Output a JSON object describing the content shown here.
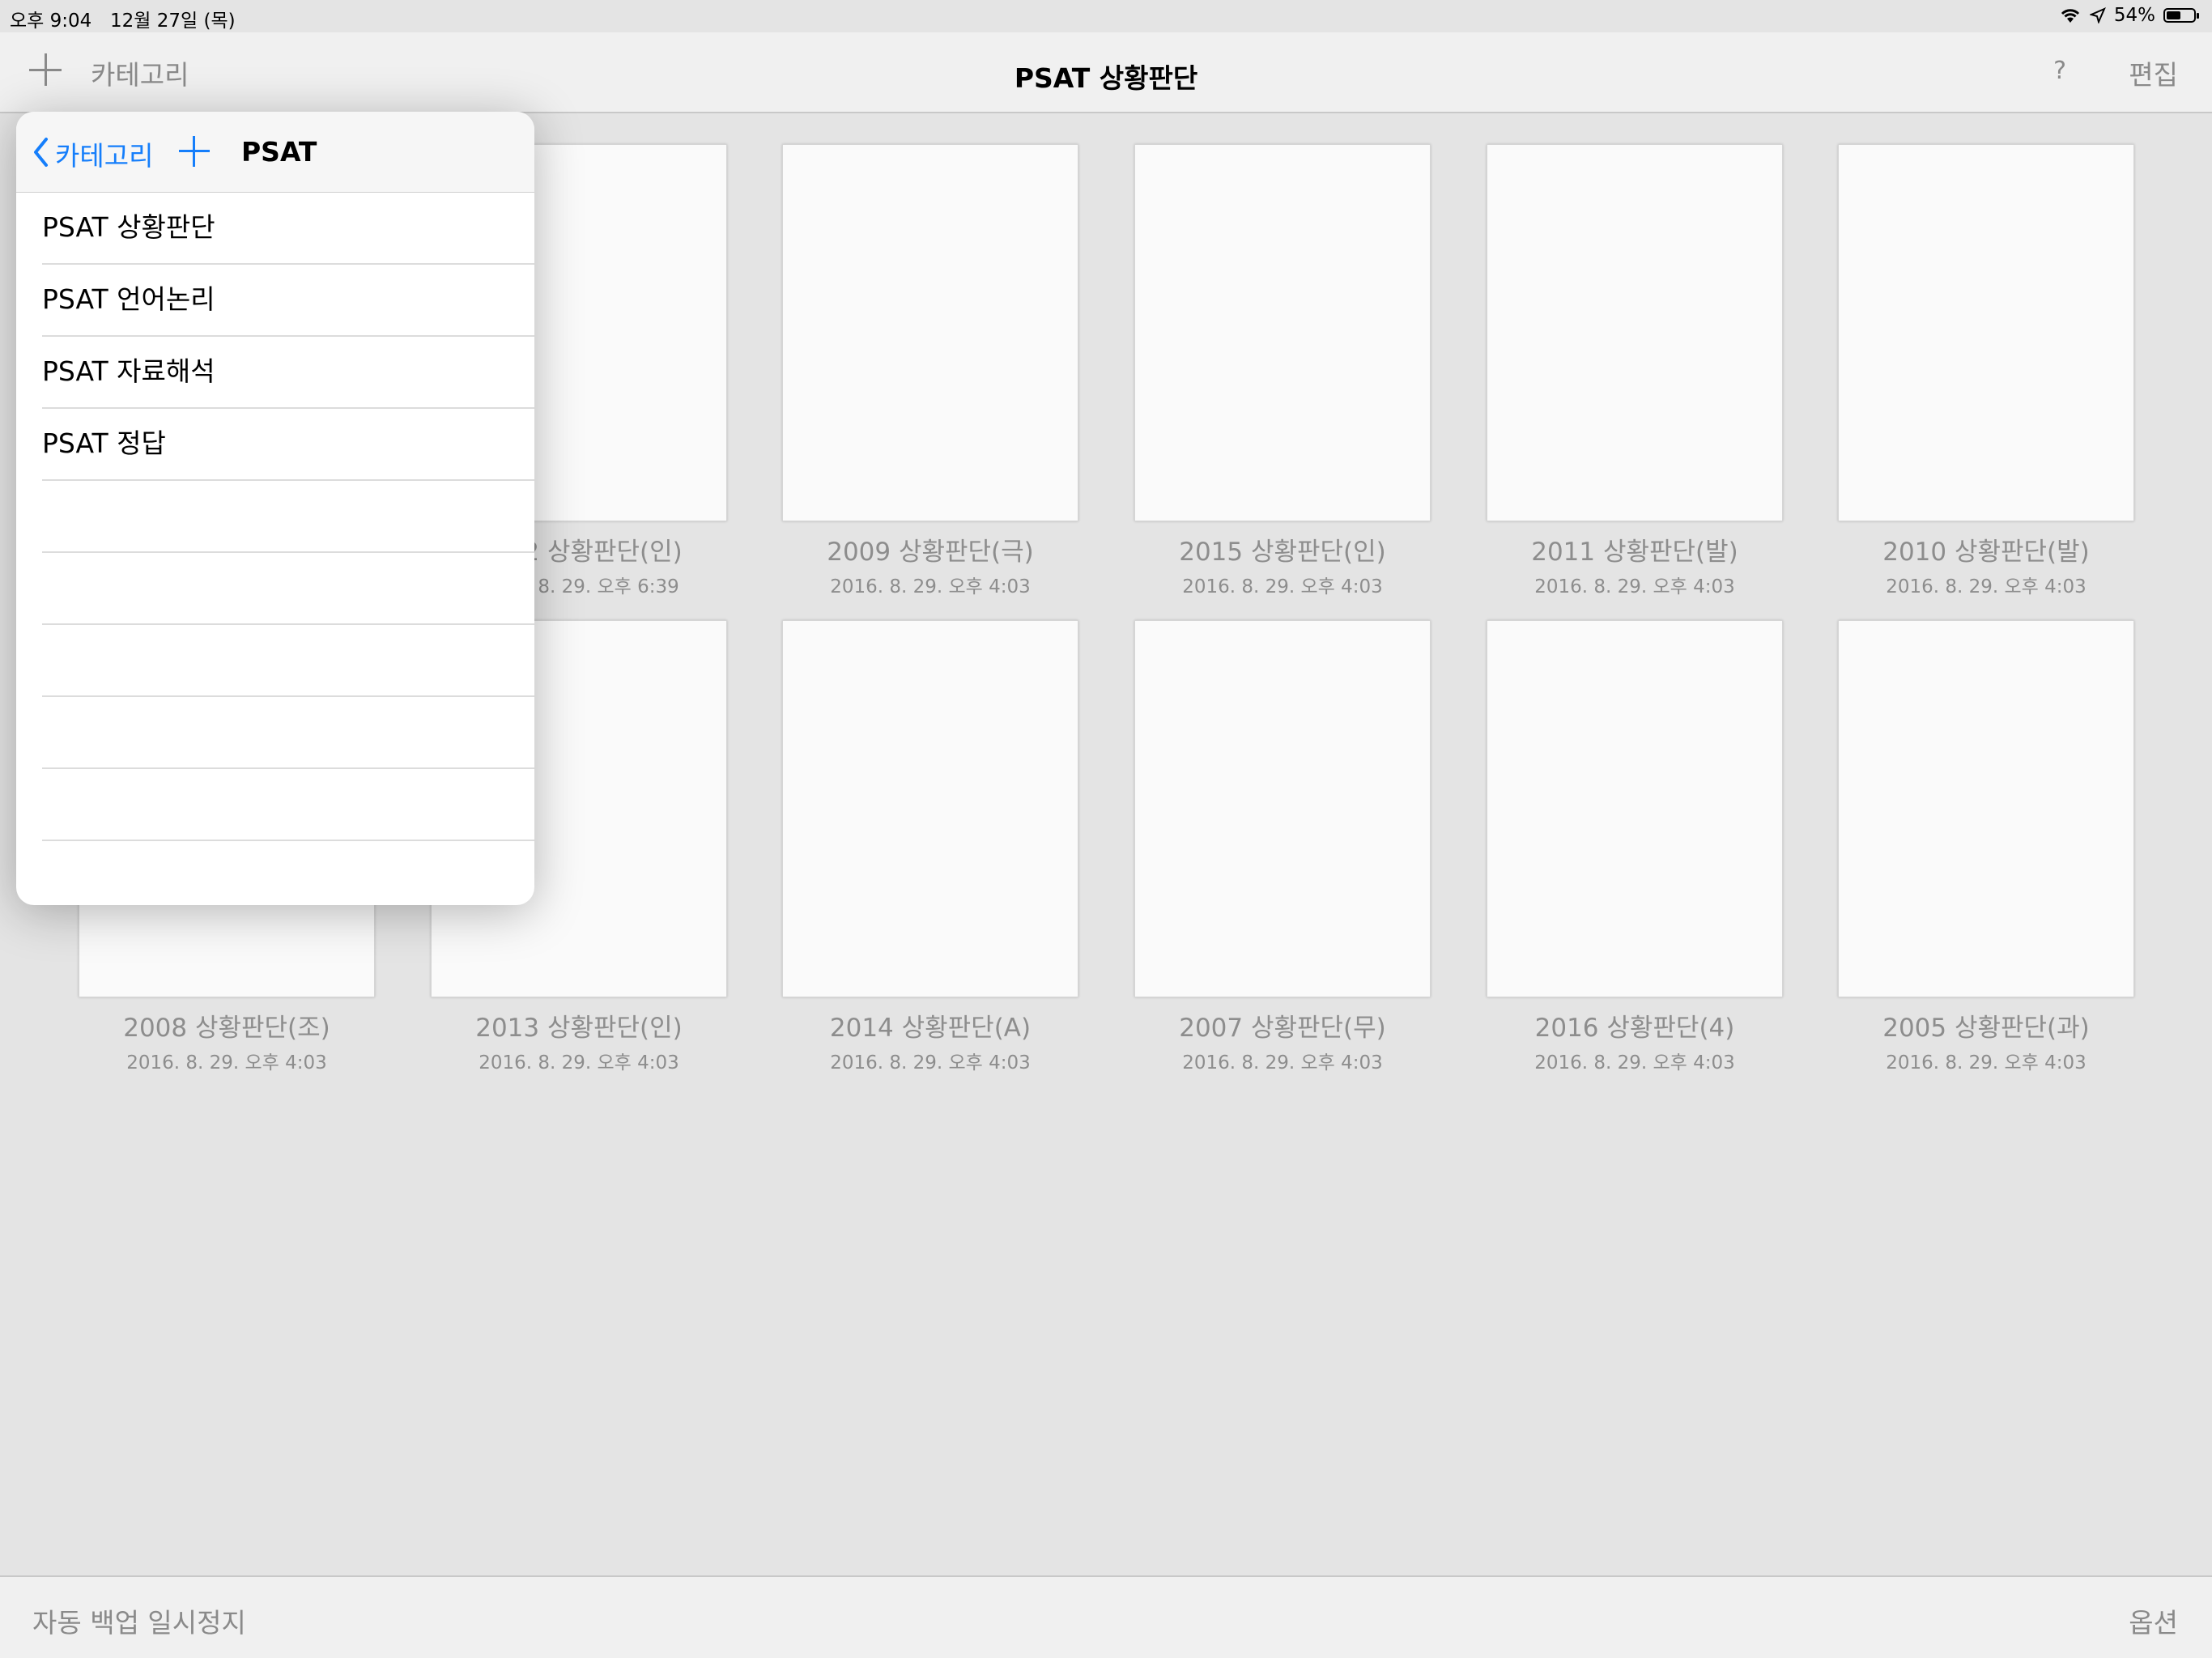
{
  "status_bar": {
    "time": "오후 9:04",
    "date": "12월 27일 (목)",
    "battery": "54%",
    "battery_level": 0.54,
    "icons": [
      "wifi-icon",
      "location-icon",
      "battery-icon"
    ]
  },
  "nav": {
    "category_label": "카테고리",
    "title": "PSAT 상황판단",
    "help_label": "?",
    "edit_label": "편집"
  },
  "documents": [
    {
      "title": "2012 상황판단(인)",
      "date": "2016. 8. 29. 오후 6:39"
    },
    {
      "title": "2009 상황판단(극)",
      "date": "2016. 8. 29. 오후 4:03"
    },
    {
      "title": "2015 상황판단(인)",
      "date": "2016. 8. 29. 오후 4:03"
    },
    {
      "title": "2011 상황판단(발)",
      "date": "2016. 8. 29. 오후 4:03"
    },
    {
      "title": "2010 상황판단(발)",
      "date": "2016. 8. 29. 오후 4:03"
    },
    {
      "title": "2008 상황판단(조)",
      "date": "2016. 8. 29. 오후 4:03"
    },
    {
      "title": "2013 상황판단(인)",
      "date": "2016. 8. 29. 오후 4:03"
    },
    {
      "title": "2014 상황판단(A)",
      "date": "2016. 8. 29. 오후 4:03"
    },
    {
      "title": "2007 상황판단(무)",
      "date": "2016. 8. 29. 오후 4:03"
    },
    {
      "title": "2016 상황판단(4)",
      "date": "2016. 8. 29. 오후 4:03"
    },
    {
      "title": "2005 상황판단(과)",
      "date": "2016. 8. 29. 오후 4:03"
    }
  ],
  "popover": {
    "back_label": "카테고리",
    "title": "PSAT",
    "items": [
      "PSAT 상황판단",
      "PSAT 언어논리",
      "PSAT 자료해석",
      "PSAT 정답",
      "",
      "",
      "",
      "",
      "",
      ""
    ]
  },
  "bottom": {
    "backup_label": "자동 백업 일시정지",
    "options_label": "옵션"
  },
  "colors": {
    "accent": "#157efb",
    "inactive": "#8a8a8a",
    "background": "#e4e4e4"
  }
}
